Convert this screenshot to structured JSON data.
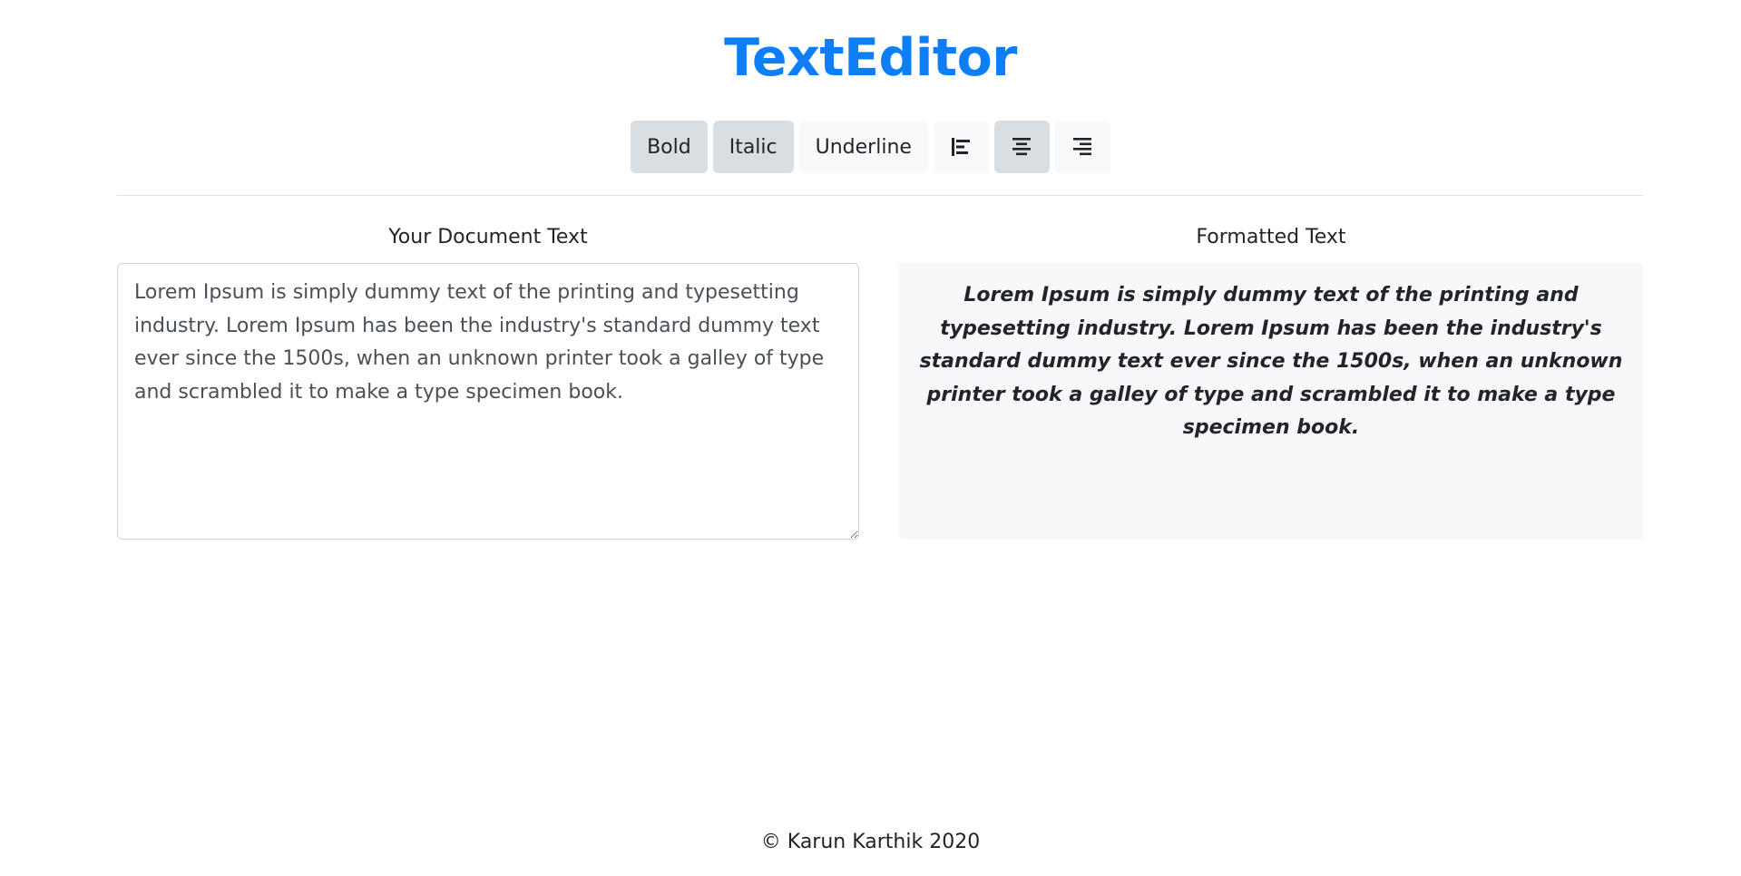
{
  "header": {
    "title": "TextEditor"
  },
  "toolbar": {
    "bold_label": "Bold",
    "italic_label": "Italic",
    "underline_label": "Underline",
    "bold_active": true,
    "italic_active": true,
    "underline_active": false,
    "alignment": "center",
    "align_left_icon": "align-left-icon",
    "align_center_icon": "align-center-icon",
    "align_right_icon": "align-right-icon"
  },
  "editor": {
    "label": "Your Document Text",
    "value": "Lorem Ipsum is simply dummy text of the printing and typesetting industry. Lorem Ipsum has been the industry's standard dummy text ever since the 1500s, when an unknown printer took a galley of type and scrambled it to make a type specimen book."
  },
  "preview": {
    "label": "Formatted Text",
    "text": "Lorem Ipsum is simply dummy text of the printing and typesetting industry. Lorem Ipsum has been the industry's standard dummy text ever since the 1500s, when an unknown printer took a galley of type and scrambled it to make a type specimen book."
  },
  "footer": {
    "text": "© Karun Karthik 2020"
  },
  "colors": {
    "brand": "#0d7ef6",
    "button_active_bg": "#d9dee3",
    "button_bg": "#f8f9fa",
    "preview_bg": "#f7f8fa"
  }
}
